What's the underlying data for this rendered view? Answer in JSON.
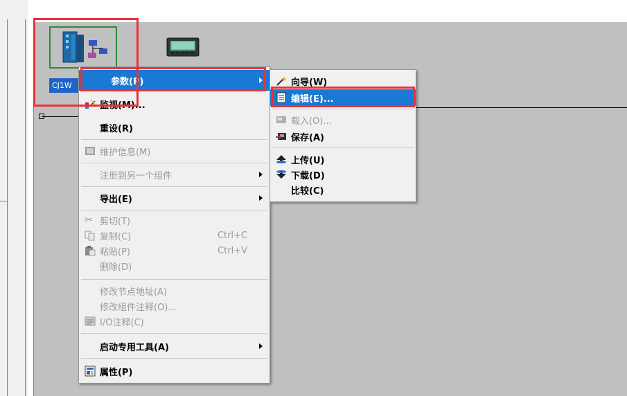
{
  "network": {
    "node_label": "CJ1W"
  },
  "context_menu": {
    "items": [
      {
        "label": "参数(P)",
        "has_submenu": true
      },
      {
        "label": "监视(M)..."
      },
      {
        "label": "重设(R)"
      },
      {
        "label": "维护信息(M)"
      },
      {
        "label": "注册到另一个组件",
        "has_submenu": true
      },
      {
        "label": "导出(E)",
        "has_submenu": true
      },
      {
        "label": "剪切(T)"
      },
      {
        "label": "复制(C)",
        "accel": "Ctrl+C"
      },
      {
        "label": "粘贴(P)",
        "accel": "Ctrl+V"
      },
      {
        "label": "删除(D)"
      },
      {
        "label": "修改节点地址(A)"
      },
      {
        "label": "修改组件注释(O)..."
      },
      {
        "label": "I/O注释(C)"
      },
      {
        "label": "启动专用工具(A)",
        "has_submenu": true
      },
      {
        "label": "属性(P)"
      }
    ]
  },
  "submenu": {
    "items": [
      {
        "label": "向导(W)"
      },
      {
        "label": "编辑(E)..."
      },
      {
        "label": "载入(O)..."
      },
      {
        "label": "保存(A)"
      },
      {
        "label": "上传(U)"
      },
      {
        "label": "下载(D)"
      },
      {
        "label": "比较(C)"
      }
    ]
  },
  "colors": {
    "highlight": "#1979d3",
    "annotation_red": "#e8323c",
    "node_border": "#2d8a3b",
    "canvas": "#c0c0c0"
  }
}
